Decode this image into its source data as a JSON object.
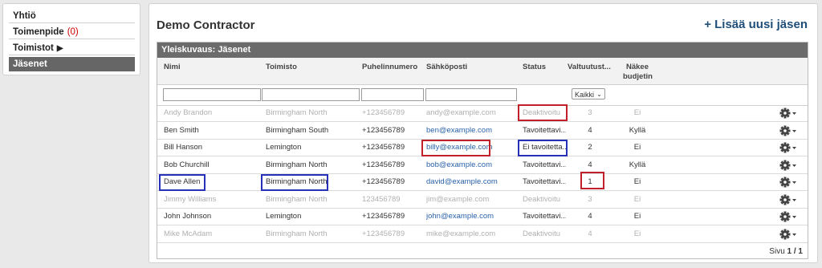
{
  "sidebar": {
    "items": [
      {
        "label": "Yhtiö"
      },
      {
        "label": "Toimenpide",
        "badge": "(0)"
      },
      {
        "label": "Toimistot",
        "arrow": "▶"
      },
      {
        "label": "Jäsenet"
      }
    ]
  },
  "page": {
    "title": "Demo Contractor",
    "add_label": "+ Lisää uusi jäsen"
  },
  "table": {
    "heading": "Yleiskuvaus: Jäsenet",
    "columns": [
      "Nimi",
      "Toimisto",
      "Puhelinnumero",
      "Sähköposti",
      "Status",
      "Valtuutust...",
      "Näkee",
      "budjetin"
    ],
    "filter_select": "Kaikki",
    "rows": [
      {
        "name": "Andy Brandon",
        "office": "Birmingham North",
        "phone": "+123456789",
        "email": "andy@example.com",
        "status": "Deaktivoitu",
        "auth": "3",
        "sees": "Ei"
      },
      {
        "name": "Ben Smith",
        "office": "Birmingham South",
        "phone": "+123456789",
        "email": "ben@example.com",
        "status": "Tavoitettavi...",
        "auth": "4",
        "sees": "Kyllä"
      },
      {
        "name": "Bill Hanson",
        "office": "Lemington",
        "phone": "+123456789",
        "email": "billy@example.com",
        "status": "Ei tavoitetta...",
        "auth": "2",
        "sees": "Ei"
      },
      {
        "name": "Bob Churchill",
        "office": "Birmingham North",
        "phone": "+123456789",
        "email": "bob@example.com",
        "status": "Tavoitettavi...",
        "auth": "4",
        "sees": "Kyllä"
      },
      {
        "name": "Dave Allen",
        "office": "Birmingham North",
        "phone": "+123456789",
        "email": "david@example.com",
        "status": "Tavoitettavi...",
        "auth": "1",
        "sees": "Ei"
      },
      {
        "name": "Jimmy Williams",
        "office": "Birmingham North",
        "phone": "123456789",
        "email": "jim@example.com",
        "status": "Deaktivoitu",
        "auth": "3",
        "sees": "Ei"
      },
      {
        "name": "John Johnson",
        "office": "Lemington",
        "phone": "+123456789",
        "email": "john@example.com",
        "status": "Tavoitettavi...",
        "auth": "4",
        "sees": "Ei"
      },
      {
        "name": "Mike McAdam",
        "office": "Birmingham North",
        "phone": "+123456789",
        "email": "mike@example.com",
        "status": "Deaktivoitu",
        "auth": "4",
        "sees": "Ei"
      }
    ],
    "pager": {
      "label": "Sivu",
      "current": "1 / 1"
    }
  },
  "colors": {
    "highlight_red": "#c0202a",
    "highlight_blue": "#2630b8",
    "link": "#2a62a8",
    "header_bar": "#6b6b6b"
  },
  "icons": {
    "row_action": "gear-icon",
    "dropdown": "chevron-down-icon"
  }
}
